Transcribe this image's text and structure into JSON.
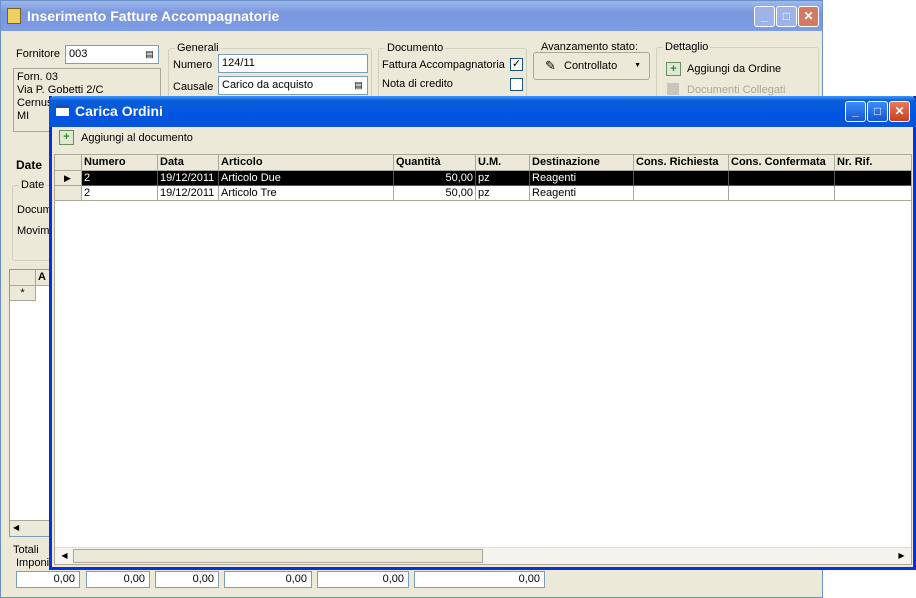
{
  "main_window": {
    "title": "Inserimento Fatture Accompagnatorie",
    "fornitore_label": "Fornitore",
    "fornitore_value": "003",
    "supplier_info": [
      "Forn. 03",
      "Via P. Gobetti 2/C",
      "Cernus",
      "MI"
    ],
    "generali_label": "Generali",
    "numero_label": "Numero",
    "numero_value": "124/11",
    "causale_label": "Causale",
    "causale_value": "Carico da acquisto",
    "documento_label": "Documento",
    "fattura_accompagnatoria_label": "Fattura Accompagnatoria",
    "fattura_accompagnatoria_checked": true,
    "nota_credito_label": "Nota di credito",
    "nota_credito_checked": false,
    "avanzamento_label": "Avanzamento stato:",
    "avanzamento_value": "Controllato",
    "dettaglio_label": "Dettaglio",
    "aggiungi_ordine_label": "Aggiungi da Ordine",
    "documenti_collegati_label": "Documenti Collegati",
    "date_tab_label": "Date",
    "date_group_label": "Date",
    "docum_label": "Docum",
    "movim_label": "Movime",
    "inner_grid_header": "A",
    "new_row_marker": "*",
    "totali_label": "Totali",
    "imponi_label": "Imponi",
    "totals": [
      "0,00",
      "0,00",
      "0,00",
      "0,00",
      "0,00",
      "0,00"
    ]
  },
  "dialog": {
    "title": "Carica Ordini",
    "add_button_label": "Aggiungi al documento",
    "columns": [
      "Numero",
      "Data",
      "Articolo",
      "Quantità",
      "U.M.",
      "Destinazione",
      "Cons. Richiesta",
      "Cons. Confermata",
      "Nr. Rif."
    ],
    "rows": [
      [
        "2",
        "19/12/2011",
        "Articolo Due",
        "50,00",
        "pz",
        "Reagenti",
        "",
        "",
        ""
      ],
      [
        "2",
        "19/12/2011",
        "Articolo Tre",
        "50,00",
        "pz",
        "Reagenti",
        "",
        "",
        ""
      ]
    ],
    "selected_row": 0
  }
}
